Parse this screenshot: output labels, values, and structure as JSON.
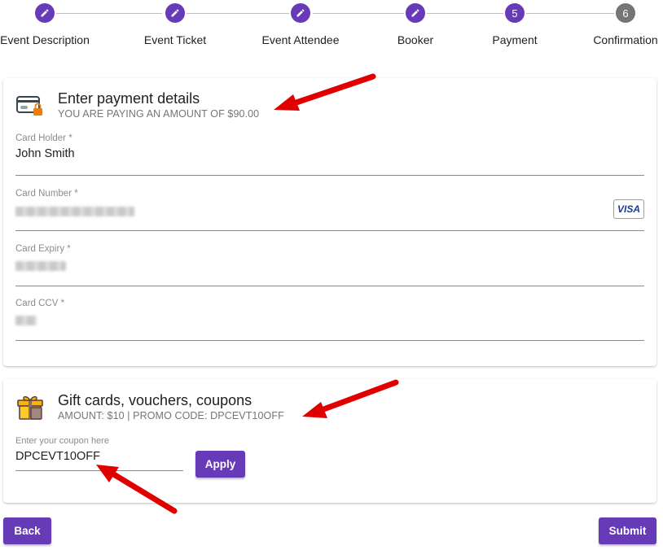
{
  "stepper": {
    "steps": [
      {
        "label": "Event Description",
        "marker": "edit-icon",
        "state": "complete"
      },
      {
        "label": "Event Ticket",
        "marker": "edit-icon",
        "state": "complete"
      },
      {
        "label": "Event Attendee",
        "marker": "edit-icon",
        "state": "complete"
      },
      {
        "label": "Booker",
        "marker": "edit-icon",
        "state": "complete"
      },
      {
        "label": "Payment",
        "number": "5",
        "state": "active"
      },
      {
        "label": "Confirmation",
        "number": "6",
        "state": "pending"
      }
    ]
  },
  "payment": {
    "icon": "credit-card-lock-icon",
    "title": "Enter payment details",
    "subtitle": "YOU ARE PAYING AN AMOUNT OF $90.00",
    "card_holder": {
      "label": "Card Holder *",
      "value": "John Smith"
    },
    "card_number": {
      "label": "Card Number *",
      "value": "",
      "brand": "VISA"
    },
    "card_expiry": {
      "label": "Card Expiry *",
      "value": ""
    },
    "card_ccv": {
      "label": "Card CCV *",
      "value": ""
    }
  },
  "gift": {
    "icon": "gift-card-icon",
    "title": "Gift cards, vouchers, coupons",
    "subtitle": "AMOUNT: $10 | PROMO CODE: DPCEVT10OFF",
    "coupon": {
      "label": "Enter your coupon here",
      "value": "DPCEVT10OFF"
    },
    "apply_label": "Apply"
  },
  "footer": {
    "back_label": "Back",
    "submit_label": "Submit"
  },
  "colors": {
    "accent": "#673ab7",
    "inactive_step": "#757575",
    "annotation_arrow": "#e00000"
  }
}
